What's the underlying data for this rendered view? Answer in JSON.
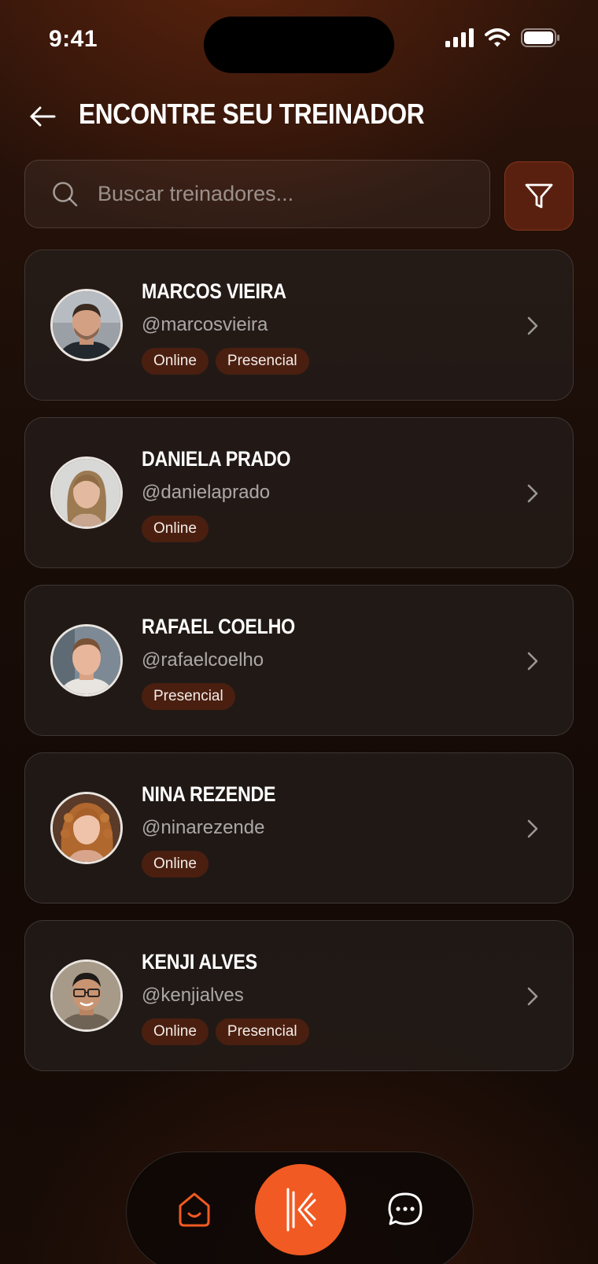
{
  "status_bar": {
    "time": "9:41"
  },
  "header": {
    "title": "ENCONTRE SEU TREINADOR",
    "back_icon": "arrow-left-icon"
  },
  "search": {
    "placeholder": "Buscar treinadores...",
    "value": "",
    "search_icon": "search-icon",
    "filter_icon": "filter-icon"
  },
  "trainers": [
    {
      "name": "MARCOS VIEIRA",
      "handle": "@marcosvieira",
      "tags": [
        "Online",
        "Presencial"
      ]
    },
    {
      "name": "DANIELA PRADO",
      "handle": "@danielaprado",
      "tags": [
        "Online"
      ]
    },
    {
      "name": "RAFAEL COELHO",
      "handle": "@rafaelcoelho",
      "tags": [
        "Presencial"
      ]
    },
    {
      "name": "NINA REZENDE",
      "handle": "@ninarezende",
      "tags": [
        "Online"
      ]
    },
    {
      "name": "KENJI ALVES",
      "handle": "@kenjialves",
      "tags": [
        "Online",
        "Presencial"
      ]
    }
  ],
  "bottom_nav": {
    "items": [
      {
        "icon": "home-icon",
        "active": true
      },
      {
        "icon": "brand-logo-icon",
        "active": false
      },
      {
        "icon": "chat-bubble-icon",
        "active": false
      }
    ]
  },
  "colors": {
    "accent": "#f15a22",
    "tag_background": "#4a1f10",
    "filter_button": "#5a200f",
    "background": "#140b07"
  }
}
